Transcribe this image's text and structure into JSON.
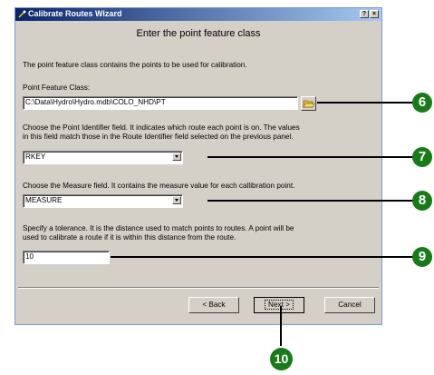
{
  "window": {
    "title": "Calibrate Routes Wizard",
    "help_button": "?",
    "close_button": "×"
  },
  "panel": {
    "heading": "Enter the point feature class",
    "intro": "The point feature class contains the points to be used for calibration.",
    "point_fc_label": "Point Feature Class:",
    "point_fc_value": "C:\\Data\\Hydro\\Hydro.mdb\\COLO_NHD\\PT",
    "identifier_desc_1": "Choose the Point Identifier field.  It indicates which route each point is on.  The values",
    "identifier_desc_2": "in this field match those in the Route Identifier field selected on the previous panel.",
    "identifier_value": "RKEY",
    "measure_desc": "Choose the Measure field.  It contains the measure value for each callibration point.",
    "measure_value": "MEASURE",
    "tolerance_desc_1": "Specify a tolerance.  It is the distance used to match points to routes.  A point will be",
    "tolerance_desc_2": "used to calibrate a route if it is within this distance from the route.",
    "tolerance_value": "10"
  },
  "buttons": {
    "back": "< Back",
    "next": "Next >",
    "cancel": "Cancel"
  },
  "callouts": {
    "c6": "6",
    "c7": "7",
    "c8": "8",
    "c9": "9",
    "c10": "10"
  },
  "colors": {
    "callout": "#1a7a1a",
    "titlebar_start": "#0a246a",
    "window_bg": "#d4d0c8"
  }
}
